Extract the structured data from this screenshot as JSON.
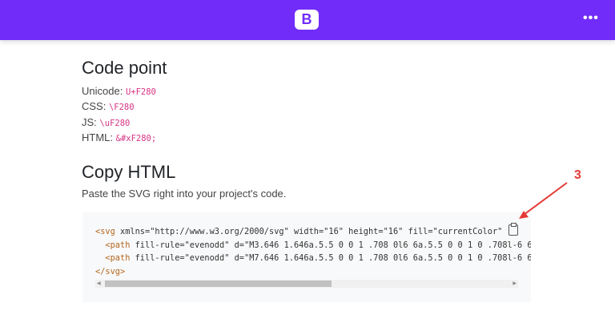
{
  "header": {
    "logo": "B",
    "menu_icon": "more-horizontal-icon",
    "color": "#712cf9"
  },
  "code_point": {
    "title": "Code point",
    "rows": [
      {
        "label": "Unicode:",
        "value": "U+F280"
      },
      {
        "label": "CSS:",
        "value": "\\F280"
      },
      {
        "label": "JS:",
        "value": "\\uF280"
      },
      {
        "label": "HTML:",
        "value": "&#xF280;"
      }
    ]
  },
  "copy_html": {
    "title": "Copy HTML",
    "description": "Paste the SVG right into your project's code.",
    "code_lines": [
      {
        "tag": "<svg",
        "rest": " xmlns=\"http://www.w3.org/2000/svg\" width=\"16\" height=\"16\" fill=\"currentColor\""
      },
      {
        "tag": "  <path",
        "rest": " fill-rule=\"evenodd\" d=\"M3.646 1.646a.5.5 0 0 1 .708 0l6 6a.5.5 0 0 1 0 .708l-6 6"
      },
      {
        "tag": "  <path",
        "rest": " fill-rule=\"evenodd\" d=\"M7.646 1.646a.5.5 0 0 1 .708 0l6 6a.5.5 0 0 1 0 .708l-6 6"
      },
      {
        "tag": "</svg>",
        "rest": ""
      }
    ],
    "copy_icon": "clipboard-icon"
  },
  "annotation": {
    "label": "3",
    "color": "#e53935"
  }
}
